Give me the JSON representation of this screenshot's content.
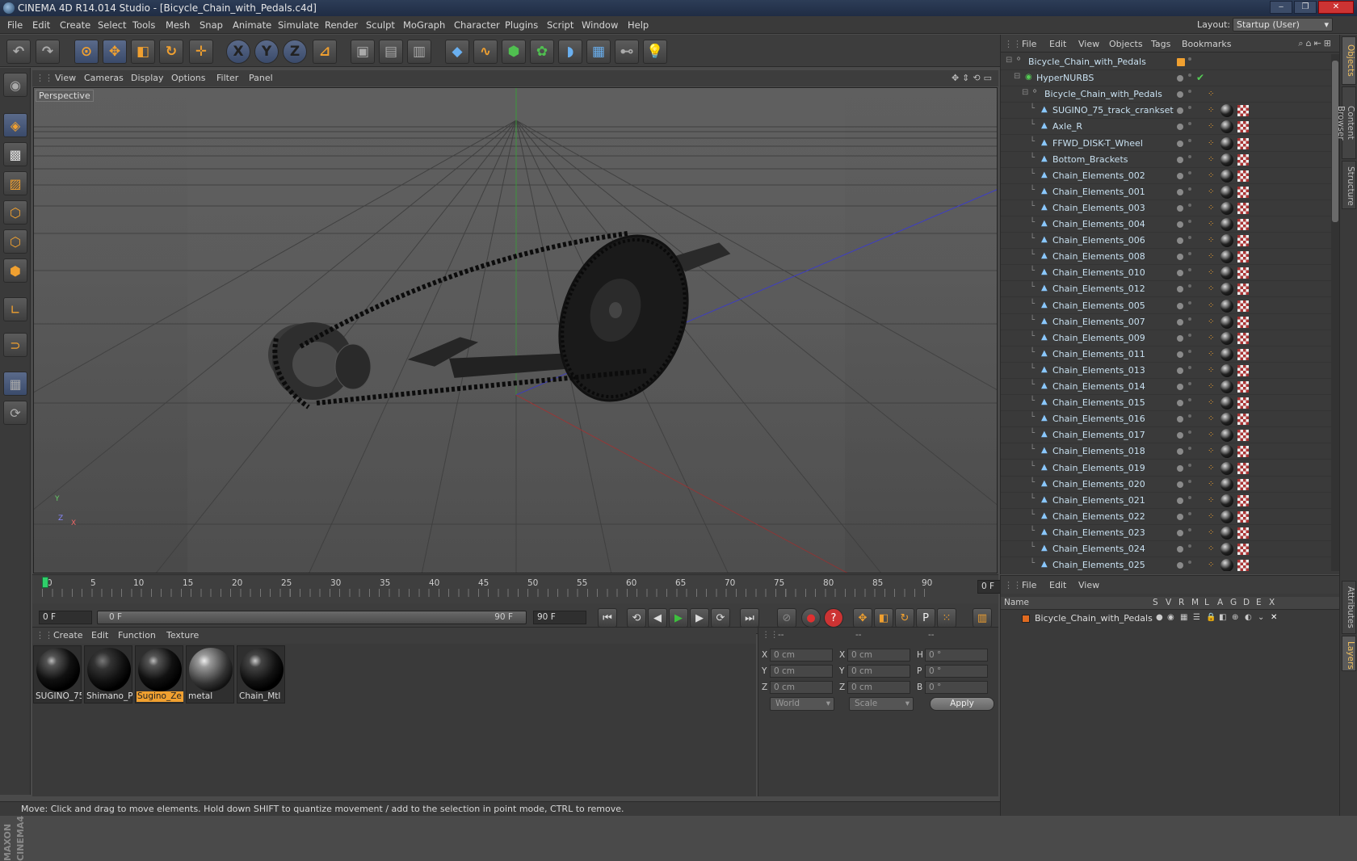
{
  "window": {
    "title": "CINEMA 4D R14.014 Studio - [Bicycle_Chain_with_Pedals.c4d]"
  },
  "menubar": {
    "items": [
      "File",
      "Edit",
      "Create",
      "Select",
      "Tools",
      "Mesh",
      "Snap",
      "Animate",
      "Simulate",
      "Render",
      "Sculpt",
      "MoGraph",
      "Character",
      "Plugins",
      "Script",
      "Window",
      "Help"
    ],
    "layout_label": "Layout:",
    "layout_value": "Startup (User)"
  },
  "viewport": {
    "menu": [
      "View",
      "Cameras",
      "Display",
      "Options",
      "Filter",
      "Panel"
    ],
    "label": "Perspective",
    "axis_y": "Y",
    "axis_z": "Z",
    "axis_x": "X"
  },
  "timeline": {
    "ticks": [
      "0",
      "5",
      "10",
      "15",
      "20",
      "25",
      "30",
      "35",
      "40",
      "45",
      "50",
      "55",
      "60",
      "65",
      "70",
      "75",
      "80",
      "85",
      "90"
    ],
    "current_frame": "0 F"
  },
  "transport": {
    "start_field": "0 F",
    "range_start": "0 F",
    "range_end": "90 F",
    "end_field": "90 F"
  },
  "materials": {
    "menu": [
      "Create",
      "Edit",
      "Function",
      "Texture"
    ],
    "items": [
      {
        "name": "SUGINO_75"
      },
      {
        "name": "Shimano_P"
      },
      {
        "name": "Sugino_Ze"
      },
      {
        "name": "metal"
      },
      {
        "name": "Chain_Mtl"
      }
    ],
    "active_index": 2
  },
  "coordinates": {
    "headers": [
      "--",
      "--",
      "--"
    ],
    "rows": [
      {
        "l1": "X",
        "v1": "0 cm",
        "l2": "X",
        "v2": "0 cm",
        "l3": "H",
        "v3": "0 °"
      },
      {
        "l1": "Y",
        "v1": "0 cm",
        "l2": "Y",
        "v2": "0 cm",
        "l3": "P",
        "v3": "0 °"
      },
      {
        "l1": "Z",
        "v1": "0 cm",
        "l2": "Z",
        "v2": "0 cm",
        "l3": "B",
        "v3": "0 °"
      }
    ],
    "space": "World",
    "mode": "Scale",
    "apply": "Apply"
  },
  "status": {
    "text": "Move: Click and drag to move elements. Hold down SHIFT to quantize movement / add to the selection in point mode, CTRL to remove."
  },
  "objects": {
    "menu": [
      "File",
      "Edit",
      "View",
      "Objects",
      "Tags",
      "Bookmarks"
    ],
    "rows": [
      {
        "name": "Bicycle_Chain_with_Pedals",
        "level": 0,
        "type": "null"
      },
      {
        "name": "HyperNURBS",
        "level": 1,
        "type": "nurbs"
      },
      {
        "name": "Bicycle_Chain_with_Pedals",
        "level": 2,
        "type": "null"
      },
      {
        "name": "SUGINO_75_track_crankset",
        "level": 3,
        "type": "poly"
      },
      {
        "name": "Axle_R",
        "level": 3,
        "type": "poly"
      },
      {
        "name": "FFWD_DISK-T_Wheel",
        "level": 3,
        "type": "poly"
      },
      {
        "name": "Bottom_Brackets",
        "level": 3,
        "type": "poly"
      },
      {
        "name": "Chain_Elements_002",
        "level": 3,
        "type": "poly"
      },
      {
        "name": "Chain_Elements_001",
        "level": 3,
        "type": "poly"
      },
      {
        "name": "Chain_Elements_003",
        "level": 3,
        "type": "poly"
      },
      {
        "name": "Chain_Elements_004",
        "level": 3,
        "type": "poly"
      },
      {
        "name": "Chain_Elements_006",
        "level": 3,
        "type": "poly"
      },
      {
        "name": "Chain_Elements_008",
        "level": 3,
        "type": "poly"
      },
      {
        "name": "Chain_Elements_010",
        "level": 3,
        "type": "poly"
      },
      {
        "name": "Chain_Elements_012",
        "level": 3,
        "type": "poly"
      },
      {
        "name": "Chain_Elements_005",
        "level": 3,
        "type": "poly"
      },
      {
        "name": "Chain_Elements_007",
        "level": 3,
        "type": "poly"
      },
      {
        "name": "Chain_Elements_009",
        "level": 3,
        "type": "poly"
      },
      {
        "name": "Chain_Elements_011",
        "level": 3,
        "type": "poly"
      },
      {
        "name": "Chain_Elements_013",
        "level": 3,
        "type": "poly"
      },
      {
        "name": "Chain_Elements_014",
        "level": 3,
        "type": "poly"
      },
      {
        "name": "Chain_Elements_015",
        "level": 3,
        "type": "poly"
      },
      {
        "name": "Chain_Elements_016",
        "level": 3,
        "type": "poly"
      },
      {
        "name": "Chain_Elements_017",
        "level": 3,
        "type": "poly"
      },
      {
        "name": "Chain_Elements_018",
        "level": 3,
        "type": "poly"
      },
      {
        "name": "Chain_Elements_019",
        "level": 3,
        "type": "poly"
      },
      {
        "name": "Chain_Elements_020",
        "level": 3,
        "type": "poly"
      },
      {
        "name": "Chain_Elements_021",
        "level": 3,
        "type": "poly"
      },
      {
        "name": "Chain_Elements_022",
        "level": 3,
        "type": "poly"
      },
      {
        "name": "Chain_Elements_023",
        "level": 3,
        "type": "poly"
      },
      {
        "name": "Chain_Elements_024",
        "level": 3,
        "type": "poly"
      },
      {
        "name": "Chain_Elements_025",
        "level": 3,
        "type": "poly"
      }
    ]
  },
  "layers": {
    "menu": [
      "File",
      "Edit",
      "View"
    ],
    "columns": [
      "Name",
      "S",
      "V",
      "R",
      "M",
      "L",
      "A",
      "G",
      "D",
      "E",
      "X"
    ],
    "rows": [
      {
        "name": "Bicycle_Chain_with_Pedals",
        "color": "#e06a20"
      }
    ]
  },
  "right_tabs": [
    "Objects",
    "Content Browser",
    "Structure",
    "Attributes",
    "Layers"
  ],
  "brand": {
    "text": "MAXON CINEMA4D"
  },
  "colors": {
    "accent": "#f0a030",
    "selection": "#5a6a8a",
    "play": "#3ec03e"
  }
}
